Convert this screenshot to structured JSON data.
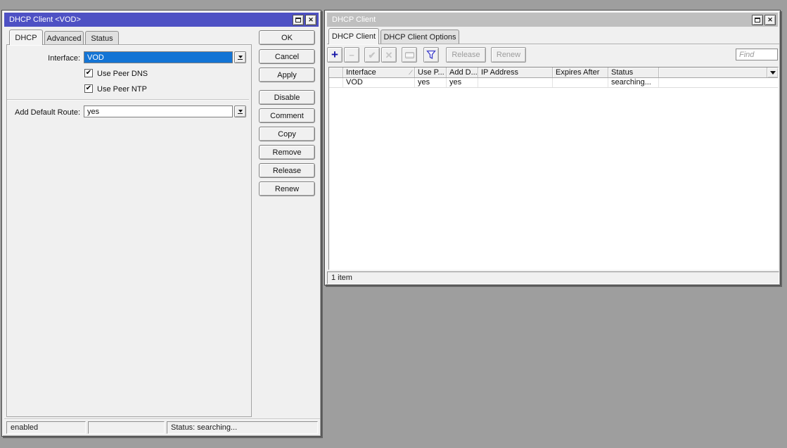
{
  "colors": {
    "desktop_bg": "#9e9e9e",
    "window_bg": "#f0f0f0",
    "active_titlebar": "#4e51c4",
    "inactive_titlebar": "#bfbfbf",
    "selection_blue": "#1374d5",
    "add_icon_blue": "#1717a8",
    "filter_icon_blue": "#3b3bc9",
    "disabled_text": "#9c9c9c"
  },
  "icons": {
    "close_glyph": "✕",
    "check_glyph": "✔",
    "add_glyph": "+",
    "remove_glyph": "−",
    "enable_glyph": "✔",
    "disable_glyph": "✕",
    "sort_glyph": "∕"
  },
  "dialog": {
    "title": "DHCP Client <VOD>",
    "tabs": [
      "DHCP",
      "Advanced",
      "Status"
    ],
    "interface_label": "Interface:",
    "interface_value": "VOD",
    "use_peer_dns_label": "Use Peer DNS",
    "use_peer_dns_checked": true,
    "use_peer_ntp_label": "Use Peer NTP",
    "use_peer_ntp_checked": true,
    "add_default_route_label": "Add Default Route:",
    "add_default_route_value": "yes",
    "buttons": [
      "OK",
      "Cancel",
      "Apply",
      "Disable",
      "Comment",
      "Copy",
      "Remove",
      "Release",
      "Renew"
    ],
    "status_left": "enabled",
    "status_middle": "",
    "status_right": "Status: searching..."
  },
  "list_window": {
    "title": "DHCP Client",
    "tabs": [
      "DHCP Client",
      "DHCP Client Options"
    ],
    "toolbar": {
      "release": "Release",
      "renew": "Renew",
      "find_placeholder": "Find"
    },
    "columns": [
      "Interface",
      "Use P...",
      "Add D...",
      "IP Address",
      "Expires After",
      "Status"
    ],
    "rows": [
      [
        "VOD",
        "yes",
        "yes",
        "",
        "",
        "searching..."
      ]
    ],
    "status": "1 item"
  }
}
